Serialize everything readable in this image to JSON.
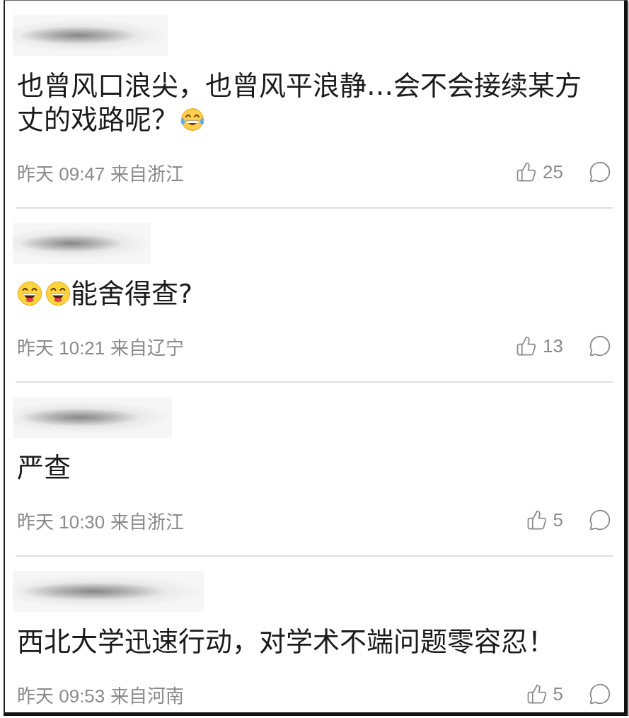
{
  "comments": [
    {
      "lines": [
        [
          {
            "kind": "text",
            "text": "也曾风口浪尖，也曾风平浪静…会不会接续某方"
          }
        ],
        [
          {
            "kind": "text",
            "text": "丈的戏路呢？"
          },
          {
            "kind": "tearjoy"
          }
        ]
      ],
      "meta": "昨天 09:47 来自浙江",
      "likes": "25"
    },
    {
      "lines": [
        [
          {
            "kind": "grin"
          },
          {
            "kind": "grin"
          },
          {
            "kind": "text",
            "text": "能舍得查?"
          }
        ]
      ],
      "meta": "昨天 10:21 来自辽宁",
      "likes": "13"
    },
    {
      "lines": [
        [
          {
            "kind": "text",
            "text": "严查"
          }
        ]
      ],
      "meta": "昨天 10:30 来自浙江",
      "likes": "5"
    },
    {
      "lines": [
        [
          {
            "kind": "text",
            "text": "西北大学迅速行动，对学术不端问题零容忍！"
          }
        ]
      ],
      "meta": "昨天 09:53 来自河南",
      "likes": "5"
    }
  ]
}
